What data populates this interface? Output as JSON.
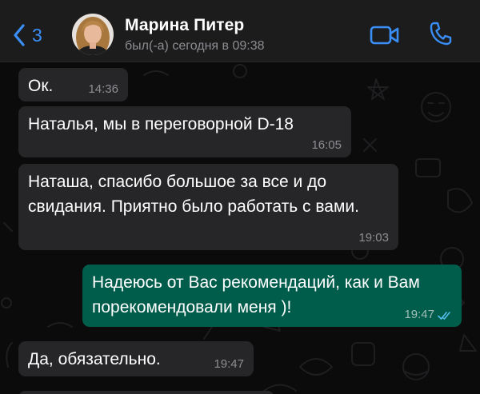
{
  "header": {
    "back_count": "3",
    "contact_name": "Марина Питер",
    "contact_status": "был(-а) сегодня в 09:38",
    "accent_color": "#3a8ff7",
    "icons": [
      "chevron-left-icon",
      "video-call-icon",
      "phone-call-icon"
    ]
  },
  "messages": [
    {
      "direction": "incoming",
      "text": "Ок.",
      "time": "14:36"
    },
    {
      "direction": "incoming",
      "text": "Наталья, мы в переговорной D-18",
      "time": "16:05"
    },
    {
      "direction": "incoming",
      "text": "Наташа, спасибо большое за все и до свидания. Приятно было работать с вами.",
      "time": "19:03"
    },
    {
      "direction": "outgoing",
      "text": "Надеюсь от Вас рекомендаций, как и Вам порекомендовали меня )!",
      "time": "19:47",
      "status": "read"
    },
    {
      "direction": "incoming",
      "text": "Да, обязательно.",
      "time": "19:47"
    }
  ],
  "colors": {
    "incoming_bubble": "#262628",
    "outgoing_bubble": "#005c4b",
    "read_ticks": "#53bdeb"
  }
}
